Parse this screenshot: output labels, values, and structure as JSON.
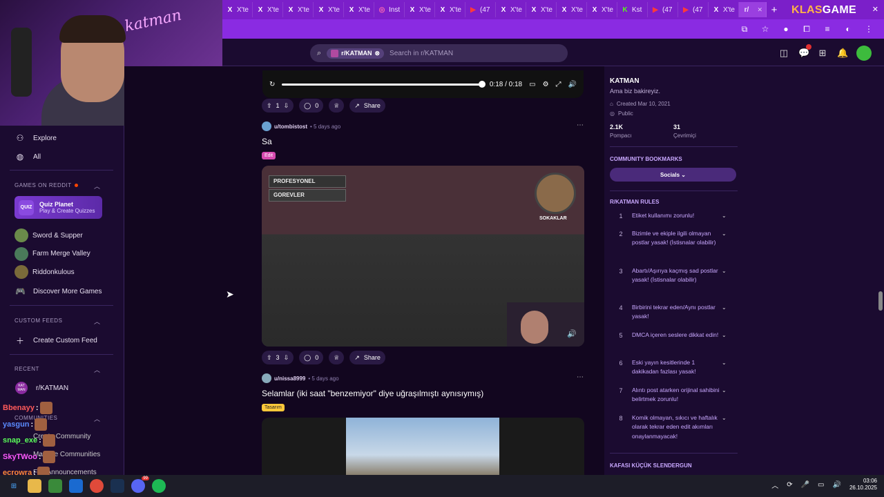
{
  "browser": {
    "tabs": [
      {
        "label": "X'te",
        "icon": "x"
      },
      {
        "label": "X'te",
        "icon": "x"
      },
      {
        "label": "X'te",
        "icon": "x"
      },
      {
        "label": "X'te",
        "icon": "x"
      },
      {
        "label": "X'te",
        "icon": "x"
      },
      {
        "label": "Inst",
        "icon": "instagram"
      },
      {
        "label": "X'te",
        "icon": "x"
      },
      {
        "label": "X'te",
        "icon": "x"
      },
      {
        "label": "(47",
        "icon": "youtube"
      },
      {
        "label": "X'te",
        "icon": "x"
      },
      {
        "label": "X'te",
        "icon": "x"
      },
      {
        "label": "X'te",
        "icon": "x"
      },
      {
        "label": "X'te",
        "icon": "x"
      },
      {
        "label": "Kst",
        "icon": "kick"
      },
      {
        "label": "(47",
        "icon": "youtube"
      },
      {
        "label": "(47",
        "icon": "youtube"
      },
      {
        "label": "X'te",
        "icon": "x"
      }
    ],
    "active_tab": "r/",
    "new_tab": "+",
    "brand_left": "KLAS",
    "brand_right": "GAME"
  },
  "header": {
    "search_chip": "r/KATMAN",
    "search_placeholder": "Search in r/KATMAN",
    "notification_count": "1"
  },
  "webcam": {
    "sign": "katman"
  },
  "left_sidebar": {
    "explore": "Explore",
    "all": "All",
    "games_header": "GAMES ON REDDIT",
    "quiz_icon": "QUIZ",
    "quiz_title": "Quiz Planet",
    "quiz_sub": "Play & Create Quizzes",
    "games": [
      "Sword & Supper",
      "Farm Merge Valley",
      "Riddonkulous"
    ],
    "discover": "Discover More Games",
    "custom_header": "CUSTOM FEEDS",
    "create_feed": "Create Custom Feed",
    "recent_header": "RECENT",
    "recent_icon": "KAT MAN",
    "recent_item": "r/KATMAN",
    "communities_header": "COMMUNITIES",
    "community_items": [
      "Create Community",
      "Manage Communities",
      "Fan Announcements"
    ]
  },
  "chat": [
    {
      "user": "Bbenayy",
      "color": "#ff5a5a"
    },
    {
      "user": "yasgun",
      "color": "#5a8aff"
    },
    {
      "user": "snap_exe",
      "color": "#5aff5a"
    },
    {
      "user": "SkyTWoo",
      "color": "#ff5aff"
    },
    {
      "user": "ecrowra",
      "color": "#ff8a3a"
    }
  ],
  "feed": {
    "video_time": "0:18 / 0:18",
    "post1_actions": {
      "votes": "1",
      "comments": "0",
      "share": "Share"
    },
    "post2": {
      "user": "u/tombistost",
      "time": "5 days ago",
      "title": "Sa",
      "flair": "Edit",
      "hud_role": "PROFESYONEL",
      "hud_tasks": "GOREVLER",
      "minimap_label": "SOKAKLAR",
      "votes": "3",
      "comments": "0",
      "share": "Share"
    },
    "post3": {
      "user": "u/nissa8999",
      "time": "5 days ago",
      "title": "Selamlar (iki saat \"benzemiyor\" diye uğraşılmıştı aynısıymış)",
      "flair": "Tasarım"
    }
  },
  "right_sidebar": {
    "name": "KATMAN",
    "desc": "Ama biz bakireyiz.",
    "created": "Created Mar 10, 2021",
    "visibility": "Public",
    "members_value": "2.1K",
    "members_label": "Pompacı",
    "online_value": "31",
    "online_label": "Çevrimiçi",
    "bookmarks_header": "COMMUNITY BOOKMARKS",
    "socials": "Socials",
    "rules_header": "R/KATMAN RULES",
    "rules": [
      {
        "n": "1",
        "text": "Etiket kullanımı zorunlu!"
      },
      {
        "n": "2",
        "text": "Bizimle ve ekiple ilgili olmayan postlar yasak! (İstisnalar olabilir)"
      },
      {
        "n": "3",
        "text": "Abartı/Aşırıya kaçmış sad postlar yasak! (İstisnalar olabilir)"
      },
      {
        "n": "4",
        "text": "Birbirini tekrar eden/Aynı postlar yasak!"
      },
      {
        "n": "5",
        "text": "DMCA içeren seslere dikkat edin!"
      },
      {
        "n": "6",
        "text": "Eski yayın kesitlerinde 1 dakikadan fazlası yasak!"
      },
      {
        "n": "7",
        "text": "Alıntı post atarken orijinal sahibini belirtmek zorunlu!"
      },
      {
        "n": "8",
        "text": "Komik olmayan, sıkıcı ve haftalık olarak tekrar eden edit akımları onaylanmayacak!"
      }
    ],
    "footer_header": "KAFASI KÜÇÜK SLENDERGUN"
  },
  "taskbar": {
    "time": "03:06",
    "date": "26.10.2025",
    "discord_badge": "99"
  }
}
